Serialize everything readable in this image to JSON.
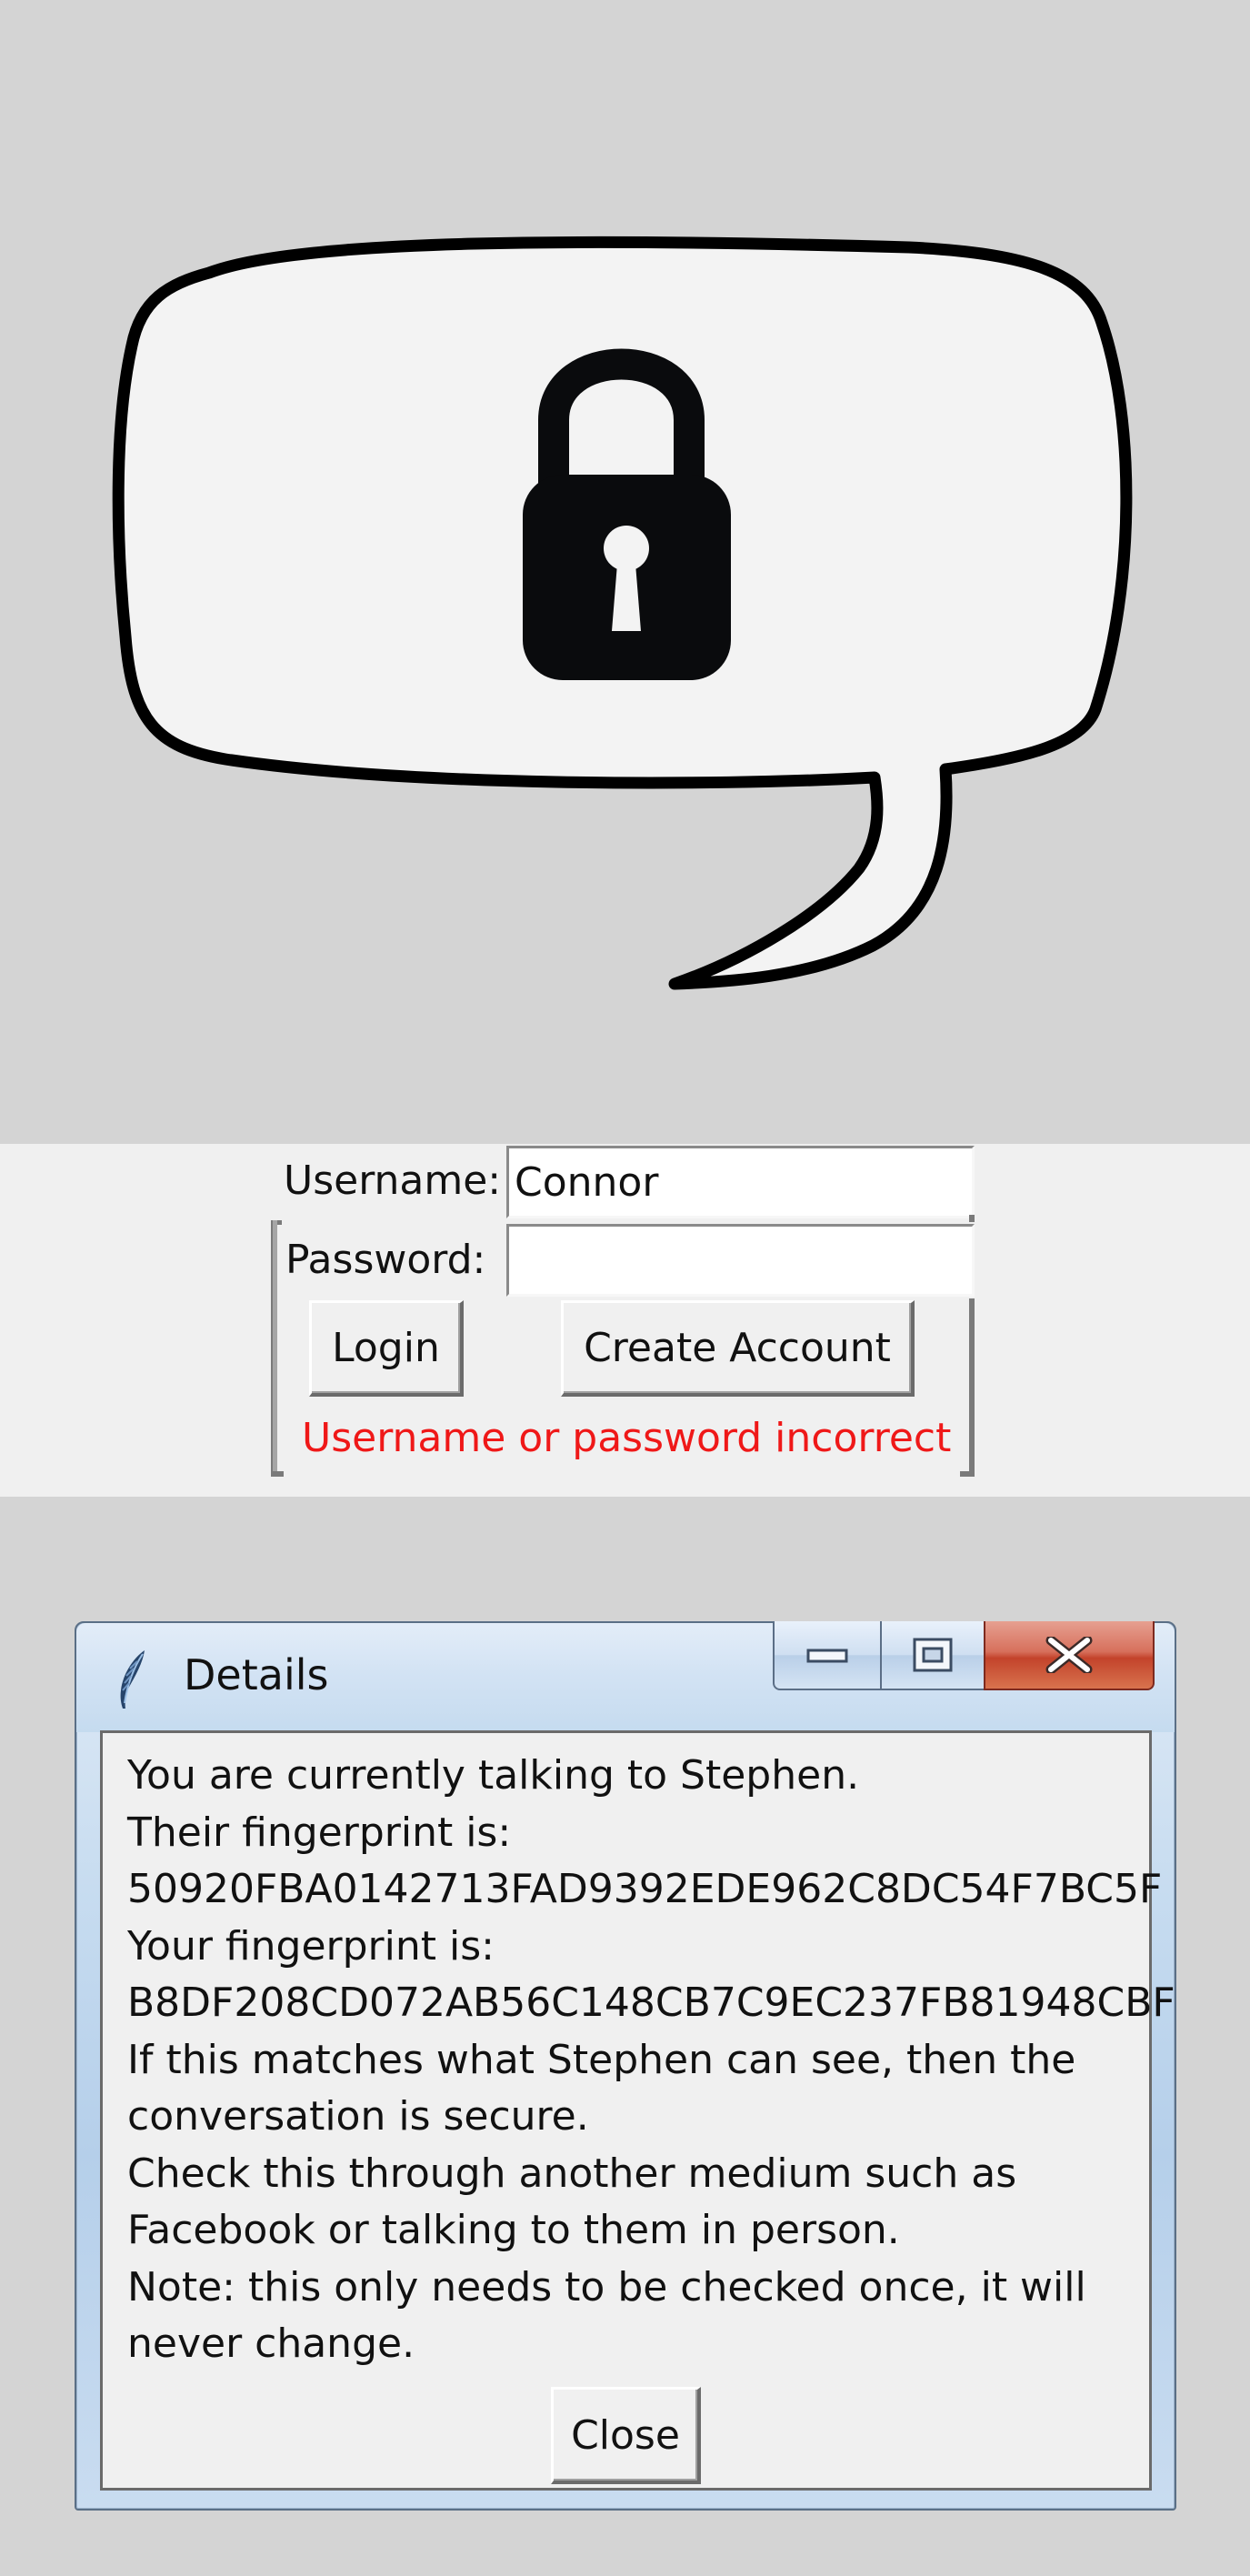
{
  "login": {
    "username_label": "Username:",
    "password_label": "Password:",
    "username_value": "Connor",
    "password_value": "",
    "login_button": "Login",
    "create_account_button": "Create Account",
    "error_message": "Username or password incorrect",
    "error_color": "#ef1818"
  },
  "dialog": {
    "title": "Details",
    "close_button": "Close",
    "lines": [
      "You are currently talking to Stephen.",
      "Their fingerprint is:",
      "50920FBA0142713FAD9392EDE962C8DC54F7BC5F",
      "Your fingerprint is:",
      "B8DF208CD072AB56C148CB7C9EC237FB81948CBF",
      "If this matches what Stephen can see, then the",
      "conversation is secure.",
      "Check this through another medium such as",
      "Facebook or talking to them in person.",
      "Note: this only needs to be checked once, it will",
      "never change."
    ]
  },
  "icons": {
    "logo": "speech-bubble-lock-icon",
    "window_icon": "feather-icon",
    "minimize": "minimize-icon",
    "maximize": "maximize-icon",
    "close": "close-icon"
  },
  "colors": {
    "background": "#d4d4d4",
    "panel": "#f0f0f0"
  }
}
